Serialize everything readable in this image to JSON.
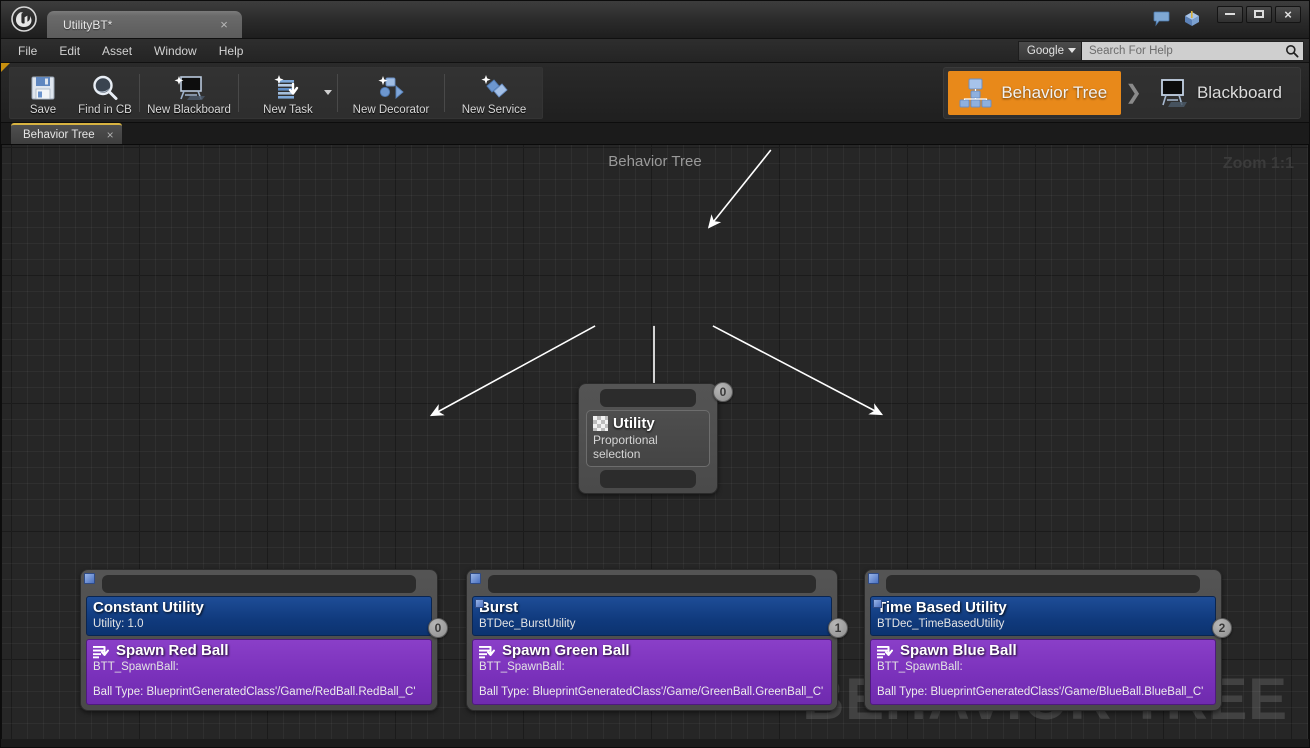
{
  "window": {
    "document_tab": "UtilityBT*",
    "document_tab_close": "×",
    "logo_name": "unreal-engine-logo",
    "controls": {
      "minimize": "minimize",
      "maximize": "maximize",
      "close": "×"
    }
  },
  "menubar": {
    "items": [
      "File",
      "Edit",
      "Asset",
      "Window",
      "Help"
    ]
  },
  "help": {
    "engine_label": "Google",
    "search_placeholder": "Search For Help",
    "search_value": ""
  },
  "toolbar": {
    "buttons": [
      {
        "label": "Save",
        "icon": "save-icon"
      },
      {
        "label": "Find in CB",
        "icon": "magnifier-icon"
      },
      {
        "label": "New Blackboard",
        "icon": "blackboard-icon"
      },
      {
        "label": "New Task",
        "icon": "new-task-icon",
        "has_dropdown": true
      },
      {
        "label": "New Decorator",
        "icon": "new-decorator-icon"
      },
      {
        "label": "New Service",
        "icon": "new-service-icon"
      }
    ]
  },
  "modes": {
    "chevron": "❯",
    "items": [
      {
        "label": "Behavior Tree",
        "icon": "behavior-tree-icon",
        "active": true
      },
      {
        "label": "Blackboard",
        "icon": "blackboard-icon",
        "active": false
      }
    ]
  },
  "panel_tabs": [
    {
      "label": "Behavior Tree",
      "close": "×",
      "active": true
    }
  ],
  "graph": {
    "title": "Behavior Tree",
    "zoom_label": "Zoom 1:1",
    "watermark": "BEHAVIOR TREE",
    "colors": {
      "accent_orange": "#e8891a",
      "decorator_blue": "#123d80",
      "task_purple": "#7a31bb",
      "node_gray": "#4a4a4a",
      "canvas_bg": "#262626",
      "wire": "#ffffff"
    },
    "nodes": [
      {
        "id": "root",
        "kind": "composite",
        "title": "Utility",
        "subtitle": "Proportional selection",
        "index": "0",
        "icon": "checker-icon"
      },
      {
        "id": "child-0",
        "kind": "child",
        "index": "0",
        "decorator": {
          "title": "Constant Utility",
          "subtitle": "Utility: 1.0"
        },
        "task": {
          "title": "Spawn Red Ball",
          "subtitle": "BTT_SpawnBall:",
          "property": "Ball Type: BlueprintGeneratedClass'/Game/RedBall.RedBall_C'",
          "icon": "task-icon"
        }
      },
      {
        "id": "child-1",
        "kind": "child",
        "index": "1",
        "decorator": {
          "title": "Burst",
          "subtitle": "BTDec_BurstUtility"
        },
        "task": {
          "title": "Spawn Green Ball",
          "subtitle": "BTT_SpawnBall:",
          "property": "Ball Type: BlueprintGeneratedClass'/Game/GreenBall.GreenBall_C'",
          "icon": "task-icon"
        }
      },
      {
        "id": "child-2",
        "kind": "child",
        "index": "2",
        "decorator": {
          "title": "Time Based Utility",
          "subtitle": "BTDec_TimeBasedUtility"
        },
        "task": {
          "title": "Spawn Blue Ball",
          "subtitle": "BTT_SpawnBall:",
          "property": "Ball Type: BlueprintGeneratedClass'/Game/BlueBall.BlueBall_C'",
          "icon": "task-icon"
        }
      }
    ]
  }
}
